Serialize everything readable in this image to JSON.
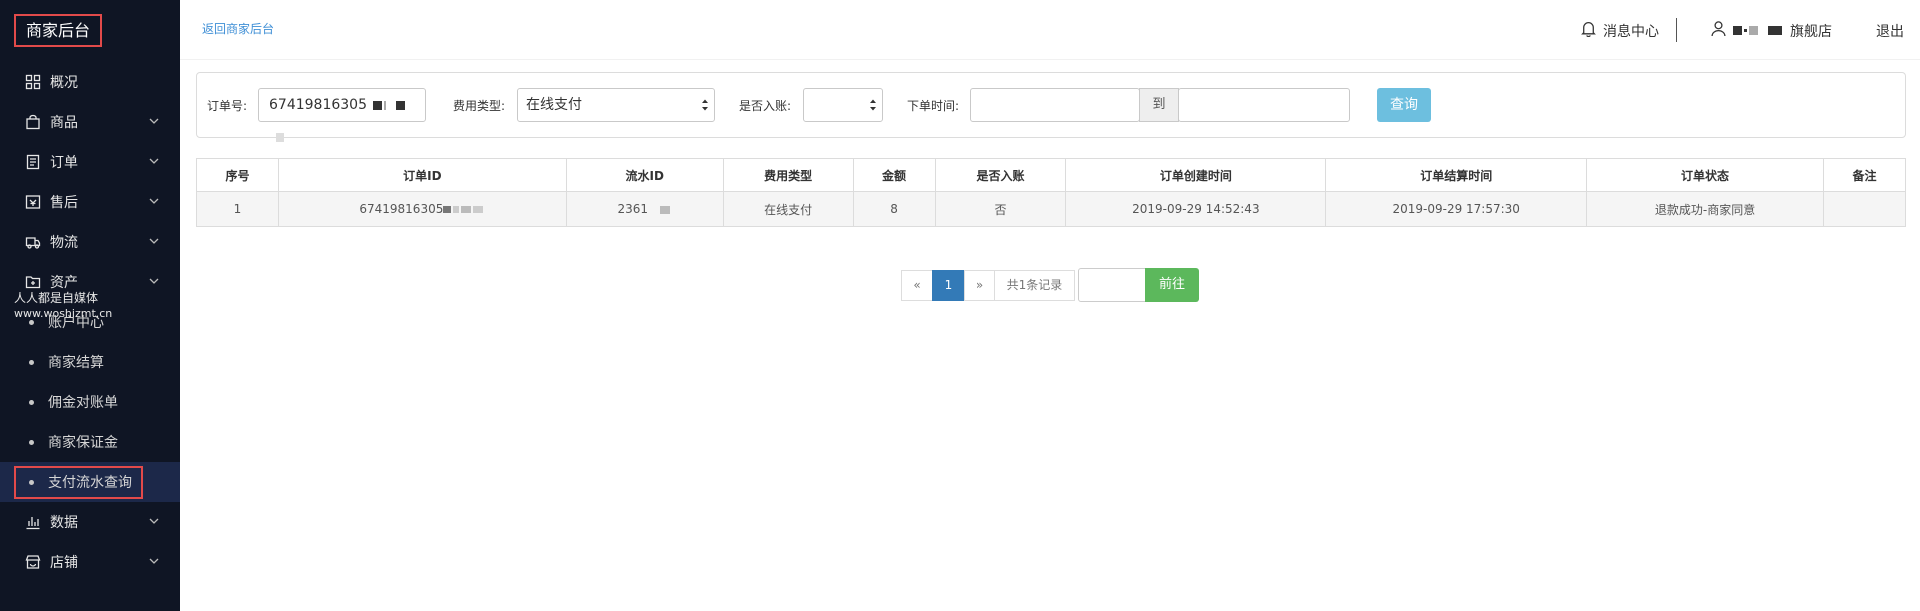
{
  "sidebar": {
    "brand": "商家后台",
    "items": [
      {
        "label": "概况",
        "icon": "dashboard-grid-icon",
        "chevron": false
      },
      {
        "label": "商品",
        "icon": "bag-icon",
        "chevron": true
      },
      {
        "label": "订单",
        "icon": "order-list-icon",
        "chevron": true
      },
      {
        "label": "售后",
        "icon": "after-sale-icon",
        "chevron": true
      },
      {
        "label": "物流",
        "icon": "truck-icon",
        "chevron": true
      },
      {
        "label": "资产",
        "icon": "folder-icon",
        "chevron": true
      }
    ],
    "sub_items": [
      {
        "label": "账户中心"
      },
      {
        "label": "商家结算"
      },
      {
        "label": "佣金对账单"
      },
      {
        "label": "商家保证金"
      },
      {
        "label": "支付流水查询",
        "active": true
      }
    ],
    "bottom_items": [
      {
        "label": "数据",
        "icon": "bar-chart-icon",
        "chevron": true
      },
      {
        "label": "店铺",
        "icon": "store-icon",
        "chevron": true
      }
    ],
    "watermark": {
      "line1": "人人都是自媒体",
      "line2": "www.woshizmt.cn"
    }
  },
  "header": {
    "back_link": "返回商家后台",
    "message_center": "消息中心",
    "store_suffix": "旗舰店",
    "logout": "退出"
  },
  "filter": {
    "order_no_label": "订单号:",
    "order_no_value": "67419816305",
    "fee_type_label": "费用类型:",
    "fee_type_value": "在线支付",
    "posted_label": "是否入账:",
    "posted_value": "",
    "time_label": "下单时间:",
    "time_to": "到",
    "query_button": "查询"
  },
  "table": {
    "headers": [
      "序号",
      "订单ID",
      "流水ID",
      "费用类型",
      "金额",
      "是否入账",
      "订单创建时间",
      "订单结算时间",
      "订单状态",
      "备注"
    ],
    "rows": [
      [
        "1",
        "67419816305",
        "2361",
        "在线支付",
        "8",
        "否",
        "2019-09-29 14:52:43",
        "2019-09-29 17:57:30",
        "退款成功-商家同意",
        ""
      ]
    ]
  },
  "pagination": {
    "prev": "«",
    "current": "1",
    "next": "»",
    "total": "共1条记录",
    "go_button": "前往"
  },
  "colors": {
    "sidebar_bg": "#0f1524",
    "active_bg": "#1c2849",
    "highlight_border": "#e24a4a",
    "link": "#3f8fd6",
    "query_btn": "#6dbfdf",
    "page_active": "#337ab7",
    "go_btn": "#5cb85c"
  }
}
